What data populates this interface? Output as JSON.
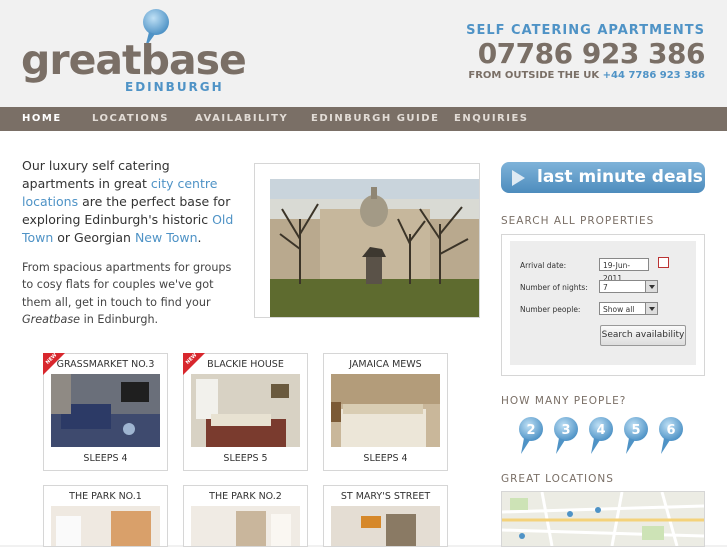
{
  "brand": {
    "name": "greatbase",
    "city": "EDINBURGH",
    "tagline": "SELF CATERING APARTMENTS",
    "phone": "07786 923 386",
    "intl_prefix": "FROM OUTSIDE THE UK",
    "intl_phone": "+44 7786 923 386",
    "accent_color": "#4f93c6",
    "brand_color": "#7a6f66"
  },
  "nav": [
    {
      "label": "HOME",
      "active": true
    },
    {
      "label": "LOCATIONS",
      "active": false
    },
    {
      "label": "AVAILABILITY",
      "active": false
    },
    {
      "label": "EDINBURGH GUIDE",
      "active": false
    },
    {
      "label": "ENQUIRIES",
      "active": false
    }
  ],
  "intro": {
    "p1_a": "Our luxury self catering apartments in great ",
    "p1_link1": "city centre locations",
    "p1_b": " are the perfect base for exploring Edinburgh's historic ",
    "p1_link2": "Old Town",
    "p1_c": " or Georgian ",
    "p1_link3": "New Town",
    "p1_d": ".",
    "p2_a": "From spacious apartments for groups to cosy flats for couples we've got them all, get in touch to find your ",
    "p2_em": "Greatbase",
    "p2_b": " in Edinburgh."
  },
  "properties": [
    {
      "title": "GRASSMARKET NO.3",
      "sleeps": "SLEEPS 4",
      "is_new": true,
      "badge": "NEW"
    },
    {
      "title": "BLACKIE HOUSE",
      "sleeps": "SLEEPS 5",
      "is_new": true,
      "badge": "NEW"
    },
    {
      "title": "JAMAICA MEWS",
      "sleeps": "SLEEPS 4",
      "is_new": false
    },
    {
      "title": "THE PARK NO.1",
      "sleeps": "",
      "is_new": false
    },
    {
      "title": "THE PARK NO.2",
      "sleeps": "",
      "is_new": false
    },
    {
      "title": "ST MARY'S STREET",
      "sleeps": "",
      "is_new": false
    }
  ],
  "sidebar": {
    "last_minute": "last minute deals",
    "search_heading": "SEARCH ALL PROPERTIES",
    "arrival_label": "Arrival date:",
    "arrival_value": "19-Jun-2011",
    "nights_label": "Number of nights:",
    "nights_value": "7",
    "people_label": "Number people:",
    "people_value": "Show all",
    "search_button": "Search availability",
    "people_heading": "HOW MANY PEOPLE?",
    "people_options": [
      "2",
      "3",
      "4",
      "5",
      "6"
    ],
    "locations_heading": "GREAT LOCATIONS"
  }
}
